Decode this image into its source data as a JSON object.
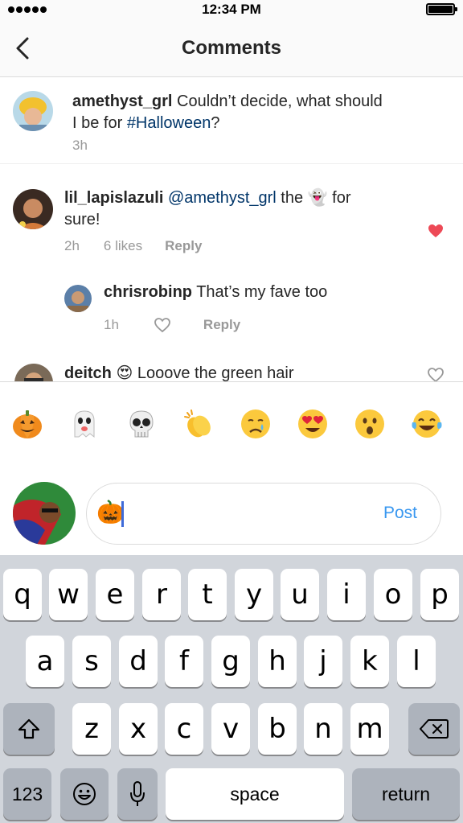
{
  "status_bar": {
    "time": "12:34 PM",
    "signal_bars": 5,
    "battery_icon": "battery-full-icon"
  },
  "nav": {
    "title": "Comments",
    "back_icon": "chevron-left-icon"
  },
  "caption": {
    "username": "amethyst_grl",
    "text_1": " Couldn’t decide, what should",
    "text_2": "I be for ",
    "hashtag": "#Halloween",
    "text_3": "?",
    "time": "3h"
  },
  "comments": [
    {
      "username": "lil_lapislazuli",
      "mention": "@amethyst_grl",
      "text_1": " the ",
      "emoji": "👻",
      "text_2": " for",
      "text_3": "sure!",
      "time": "2h",
      "likes": "6 likes",
      "reply": "Reply",
      "liked": true
    },
    {
      "username": "chrisrobinp",
      "text": " That’s my fave too",
      "time": "1h",
      "reply": "Reply",
      "liked": false
    },
    {
      "username": "deitch",
      "emoji": "😍",
      "text": " Looove the green hair",
      "liked": false
    }
  ],
  "emoji_bar": [
    "🎃",
    "👻",
    "💀",
    "👏",
    "😢",
    "😍",
    "😮",
    "😂"
  ],
  "composer": {
    "text": "🎃",
    "post_label": "Post"
  },
  "keyboard": {
    "row1": [
      "q",
      "w",
      "e",
      "r",
      "t",
      "y",
      "u",
      "i",
      "o",
      "p"
    ],
    "row2": [
      "a",
      "s",
      "d",
      "f",
      "g",
      "h",
      "j",
      "k",
      "l"
    ],
    "row3": [
      "z",
      "x",
      "c",
      "v",
      "b",
      "n",
      "m"
    ],
    "numbers_label": "123",
    "space_label": "space",
    "return_label": "return"
  },
  "colors": {
    "link": "#003569",
    "accent": "#3897f0",
    "heart": "#ed4956",
    "muted": "#999999"
  }
}
